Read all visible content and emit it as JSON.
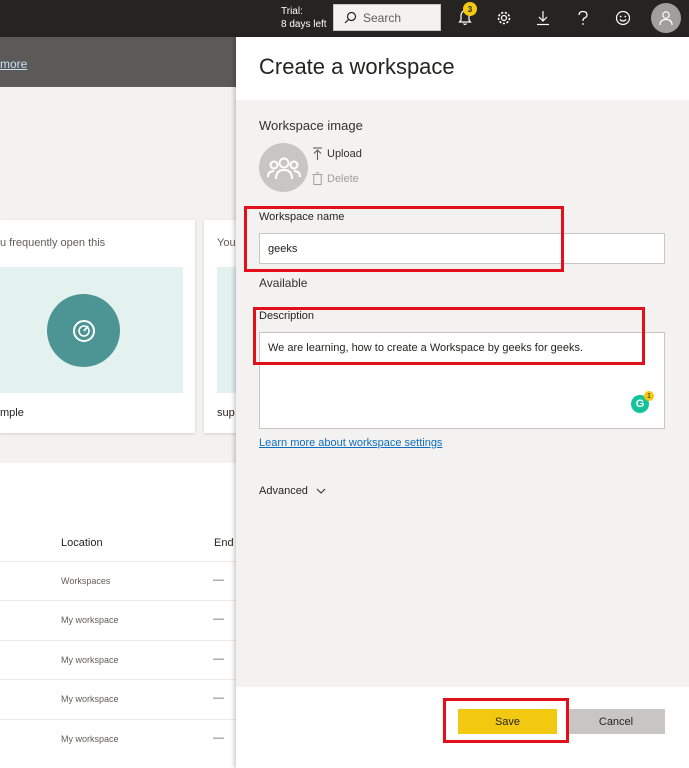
{
  "topbar": {
    "trial_line1": "Trial:",
    "trial_line2": "8 days left",
    "search_label": "Search",
    "notification_count": "3",
    "icons": [
      "bell-icon",
      "gear-icon",
      "download-icon",
      "help-icon",
      "smiley-icon",
      "user-icon"
    ]
  },
  "background": {
    "banner_link": "more",
    "card1_text": "u frequently open this",
    "card1_bottom": "mple",
    "card2_text": "You",
    "card2_bottom": "sup",
    "columns": {
      "location": "Location",
      "end": "End"
    },
    "rows": [
      {
        "location": "Workspaces",
        "end": "—"
      },
      {
        "location": "My workspace",
        "end": "—"
      },
      {
        "location": "My workspace",
        "end": "—"
      },
      {
        "location": "My workspace",
        "end": "—"
      },
      {
        "location": "My workspace",
        "end": "—"
      }
    ]
  },
  "panel": {
    "title": "Create a workspace",
    "image_label": "Workspace image",
    "upload_label": "Upload",
    "delete_label": "Delete",
    "name_label": "Workspace name",
    "name_value": "geeks",
    "availability": "Available",
    "description_label": "Description",
    "description_value": "We are learning, how to create a Workspace by geeks for geeks.",
    "learn_more": "Learn more about workspace settings",
    "advanced_label": "Advanced",
    "save_label": "Save",
    "cancel_label": "Cancel",
    "grammarly_letter": "G",
    "grammarly_count": "1"
  },
  "colors": {
    "topbar": "#252423",
    "accent_yellow": "#f2c811",
    "annotation_red": "#e3101c",
    "link_blue": "#106ebe",
    "teal": "#4c9594"
  }
}
